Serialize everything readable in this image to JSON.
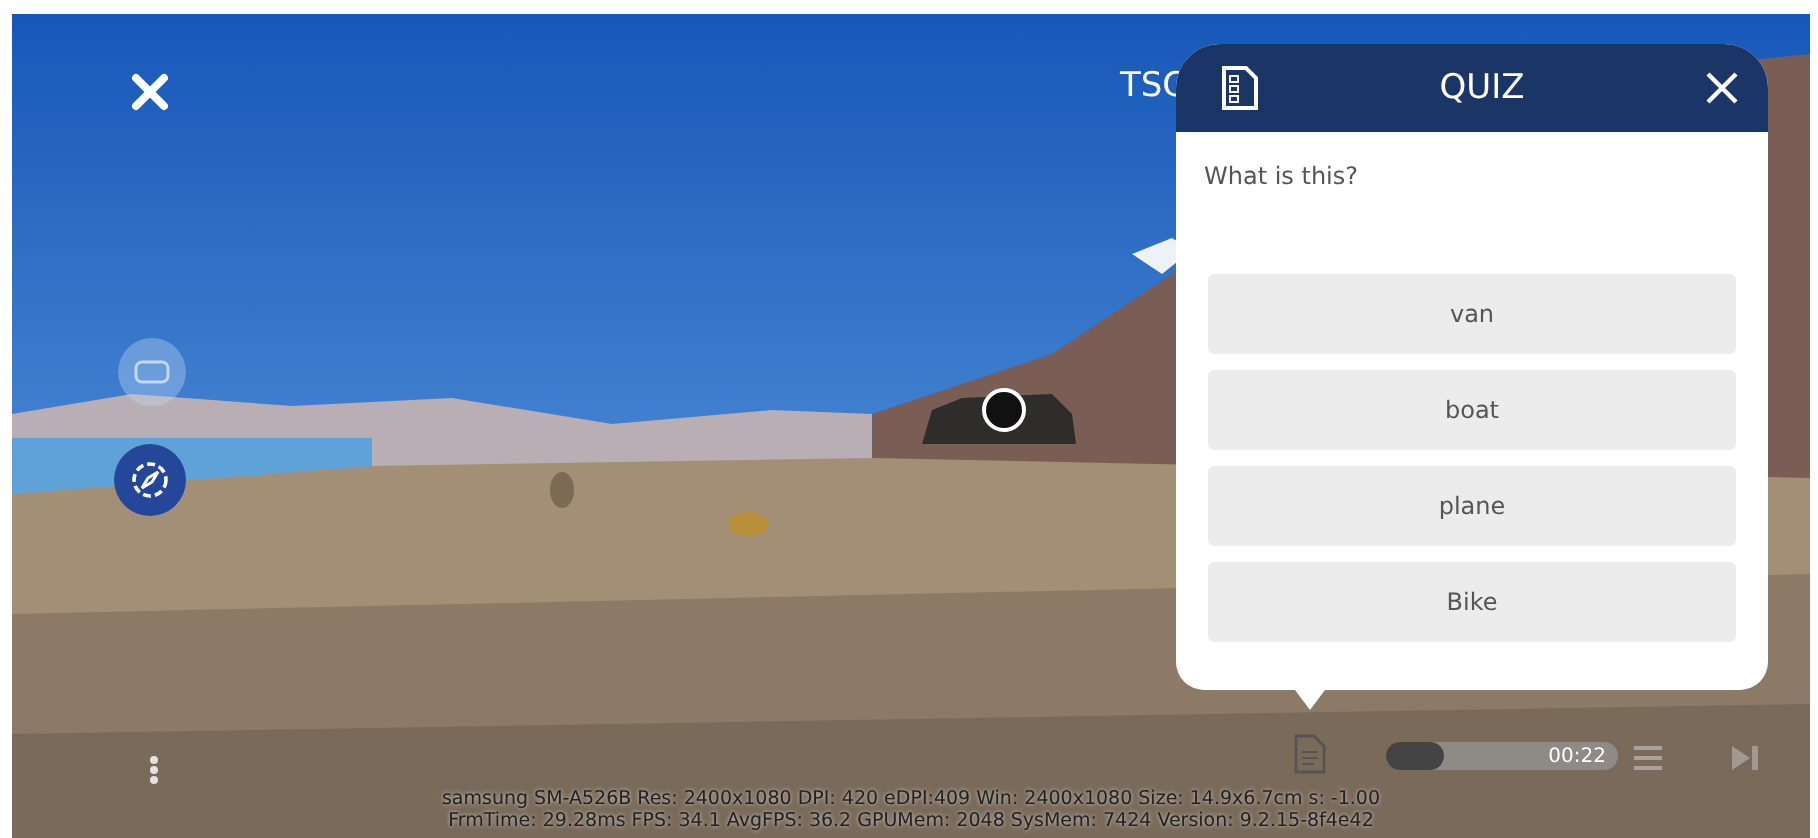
{
  "viewer": {
    "title": "TSC"
  },
  "quiz": {
    "title": "QUIZ",
    "question": "What is this?",
    "options": [
      {
        "label": "van"
      },
      {
        "label": "boat"
      },
      {
        "label": "plane"
      },
      {
        "label": "Bike"
      }
    ]
  },
  "player": {
    "level": 0.25,
    "time": "00:22"
  },
  "debug": {
    "lines": [
      "samsung SM-A526B  Res: 2400x1080  DPI: 420  eDPI:409  Win: 2400x1080  Size: 14.9x6.7cm  s: -1.00",
      "FrmTime: 29.28ms  FPS: 34.1  AvgFPS: 36.2  GPUMem: 2048  SysMem: 7424  Version: 9.2.15-8f4e42"
    ]
  }
}
